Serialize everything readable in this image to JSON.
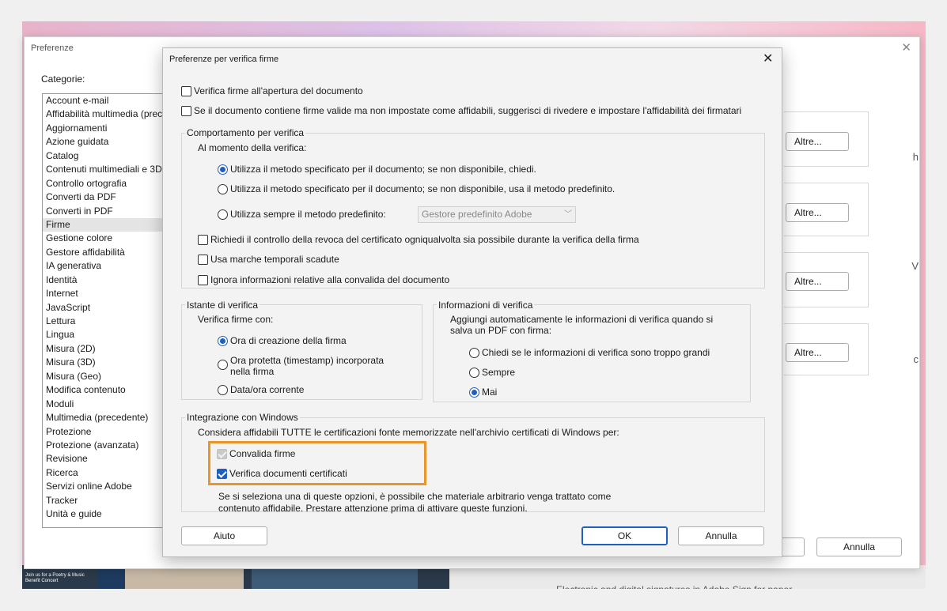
{
  "background": {
    "promo_text": "Join us for a Poetry & Music Benefit Concert",
    "footer_text": "Electronic and digital signatures in Adobe Sign for paper"
  },
  "pref_window": {
    "title": "Preferenze",
    "categories_label": "Categorie:",
    "categories": [
      "Account e-mail",
      "Affidabilità multimedia (prec",
      "Aggiornamenti",
      "Azione guidata",
      "Catalog",
      "Contenuti multimediali e 3D",
      "Controllo ortografia",
      "Converti da PDF",
      "Converti in PDF",
      "Firme",
      "Gestione colore",
      "Gestore affidabilità",
      "IA generativa",
      "Identità",
      "Internet",
      "JavaScript",
      "Lettura",
      "Lingua",
      "Misura (2D)",
      "Misura (3D)",
      "Misura (Geo)",
      "Modifica contenuto",
      "Moduli",
      "Multimedia (precedente)",
      "Protezione",
      "Protezione (avanzata)",
      "Revisione",
      "Ricerca",
      "Servizi online Adobe",
      "Tracker",
      "Unità e guide"
    ],
    "selected_category": "Firme",
    "more_button_label": "Altre...",
    "cancel_label": "Annulla",
    "edge_chars": [
      "h",
      "V",
      "c"
    ]
  },
  "dialog": {
    "title": "Preferenze per verifica firme",
    "verify_on_open": {
      "label": "Verifica firme all'apertura del documento",
      "checked": false
    },
    "suggest_trust": {
      "label": "Se il documento contiene firme valide ma non impostate come affidabili, suggerisci di rivedere e impostare l'affidabilità dei firmatari",
      "checked": false
    },
    "behavior": {
      "title": "Comportamento per verifica",
      "subtitle": "Al momento della verifica:",
      "options": [
        {
          "label": "Utilizza il metodo specificato per il documento; se non disponibile, chiedi.",
          "checked": true
        },
        {
          "label": "Utilizza il metodo specificato per il documento; se non disponibile, usa il metodo predefinito.",
          "checked": false
        },
        {
          "label": "Utilizza sempre il metodo predefinito:",
          "checked": false
        }
      ],
      "default_method": "Gestore predefinito Adobe",
      "checkboxes": [
        {
          "label": "Richiedi il controllo della revoca del certificato ogniqualvolta sia possibile durante la verifica della firma",
          "checked": false
        },
        {
          "label": "Usa marche temporali scadute",
          "checked": false
        },
        {
          "label": "Ignora informazioni relative alla convalida del documento",
          "checked": false
        }
      ]
    },
    "verification_time": {
      "title": "Istante di verifica",
      "subtitle": "Verifica firme con:",
      "options": [
        {
          "label": "Ora di creazione della firma",
          "checked": true
        },
        {
          "label": "Ora protetta (timestamp) incorporata",
          "label2": "nella firma",
          "checked": false
        },
        {
          "label": "Data/ora corrente",
          "checked": false
        }
      ]
    },
    "verification_info": {
      "title": "Informazioni di verifica",
      "desc1": "Aggiungi automaticamente le informazioni di verifica quando si",
      "desc2": "salva un PDF con firma:",
      "options": [
        {
          "label": "Chiedi se le informazioni di verifica sono troppo grandi",
          "checked": false
        },
        {
          "label": "Sempre",
          "checked": false
        },
        {
          "label": "Mai",
          "checked": true
        }
      ]
    },
    "windows": {
      "title": "Integrazione con Windows",
      "subtitle": "Considera affidabili TUTTE le certificazioni fonte memorizzate nell'archivio certificati di Windows per:",
      "validate": {
        "label": "Convalida firme",
        "checked": true,
        "disabled": true
      },
      "certified": {
        "label": "Verifica documenti certificati",
        "checked": true
      },
      "warning1": "Se si seleziona una di queste opzioni, è possibile che materiale arbitrario venga trattato come",
      "warning2": "contenuto affidabile. Prestare attenzione prima di attivare queste funzioni.",
      "highlight_color": "#e8962a"
    },
    "buttons": {
      "help": "Aiuto",
      "ok": "OK",
      "cancel": "Annulla"
    }
  }
}
